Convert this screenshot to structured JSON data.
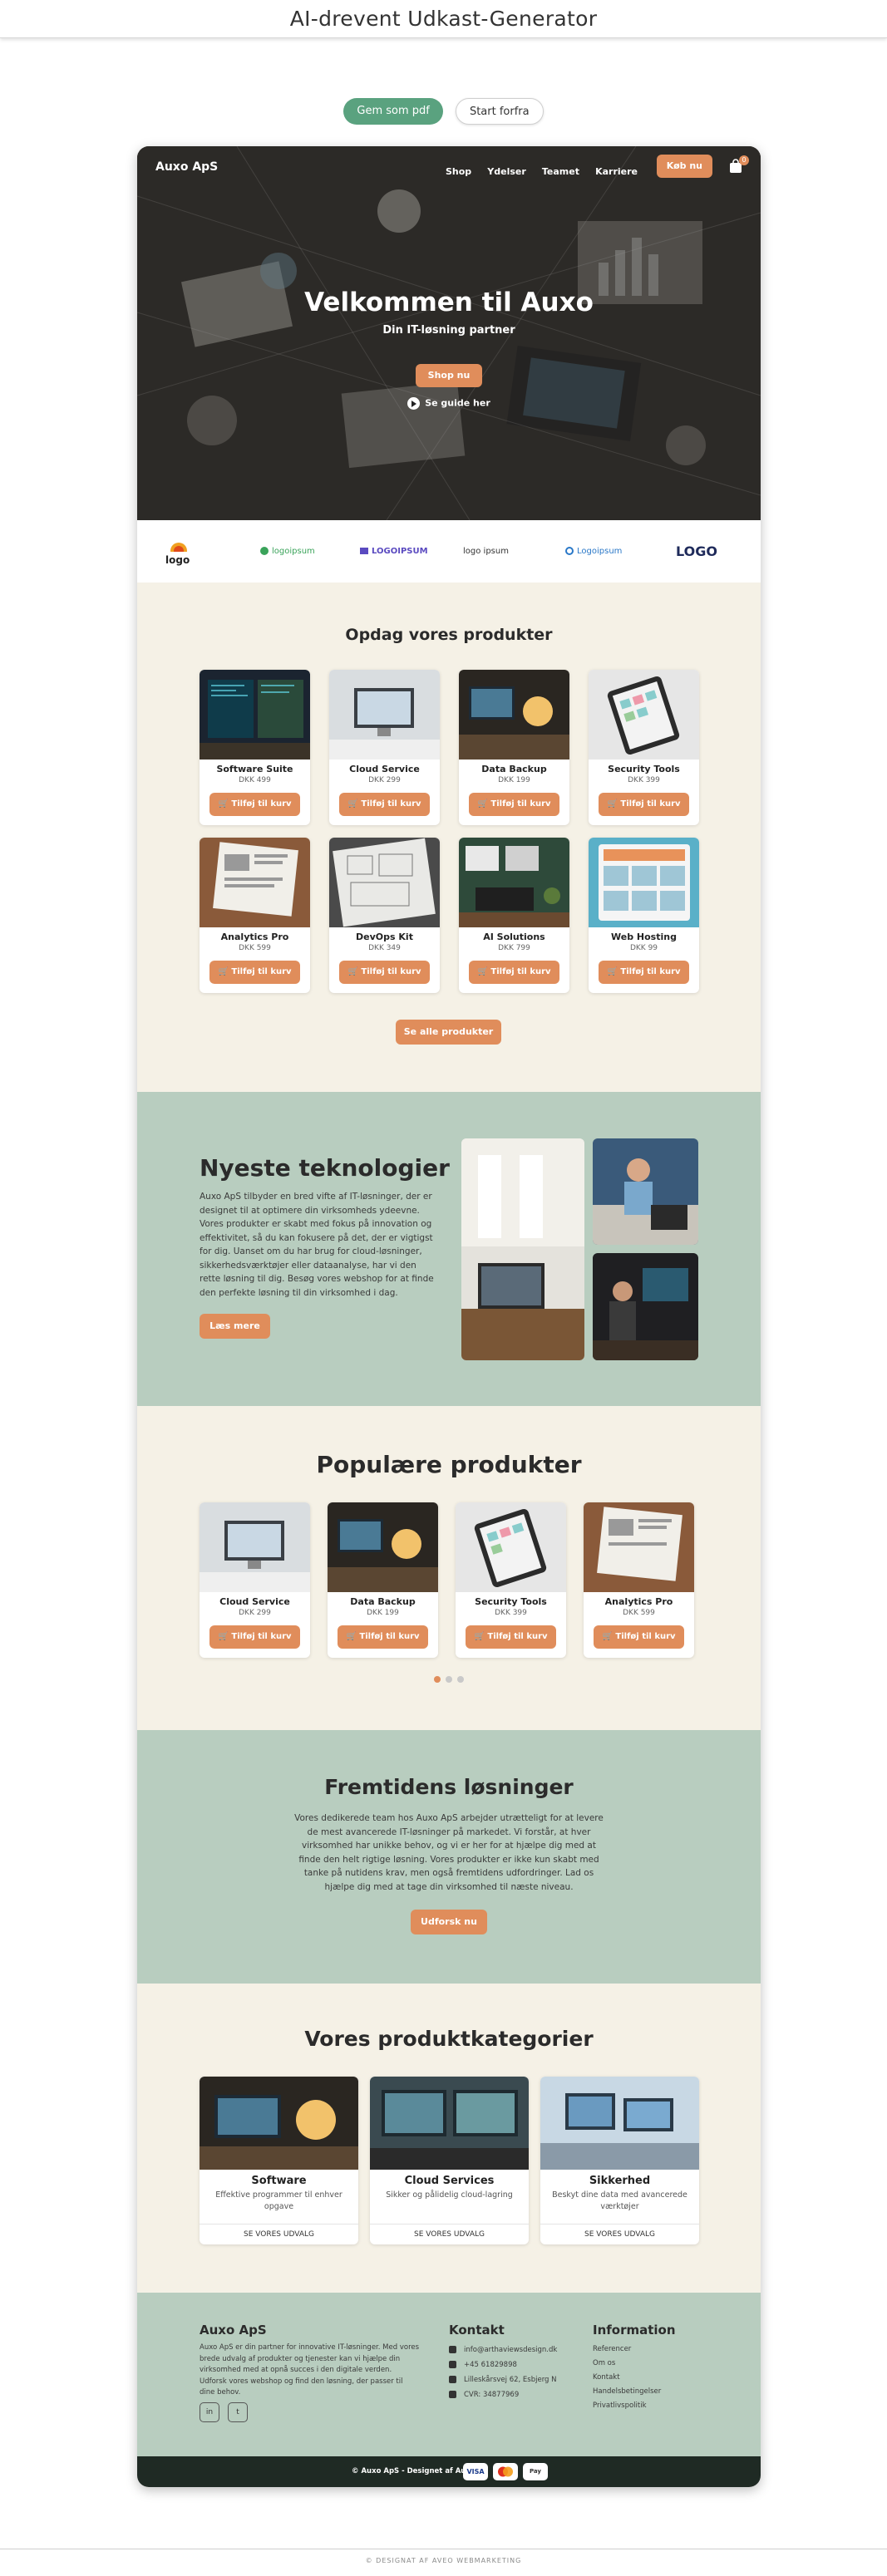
{
  "app": {
    "title": "AI-drevent Udkast-Generator",
    "save_pdf": "Gem som pdf",
    "restart": "Start forfra",
    "footer": "© DESIGNAT AF AVEO WEBMARKETING"
  },
  "nav": {
    "brand": "Auxo ApS",
    "links": [
      "Shop",
      "Ydelser",
      "Teamet",
      "Karriere"
    ],
    "cta": "Køb nu",
    "cart_count": "0"
  },
  "hero": {
    "title": "Velkommen til Auxo",
    "subtitle": "Din IT-løsning partner",
    "button": "Shop nu",
    "guide": "Se guide her"
  },
  "logos": [
    "logo",
    "logoipsum",
    "LOGOIPSUM",
    "logo ipsum",
    "Logoipsum",
    "LOGO"
  ],
  "products": {
    "title": "Opdag vores produkter",
    "add_label": "Tilføj til kurv",
    "items": [
      {
        "name": "Software Suite",
        "price": "DKK 499"
      },
      {
        "name": "Cloud Service",
        "price": "DKK 299"
      },
      {
        "name": "Data Backup",
        "price": "DKK 199"
      },
      {
        "name": "Security Tools",
        "price": "DKK 399"
      },
      {
        "name": "Analytics Pro",
        "price": "DKK 599"
      },
      {
        "name": "DevOps Kit",
        "price": "DKK 349"
      },
      {
        "name": "AI Solutions",
        "price": "DKK 799"
      },
      {
        "name": "Web Hosting",
        "price": "DKK 99"
      }
    ],
    "see_all": "Se alle produkter"
  },
  "tech": {
    "title": "Nyeste teknologier",
    "text": "Auxo ApS tilbyder en bred vifte af IT-løsninger, der er designet til at optimere din virksomheds ydeevne. Vores produkter er skabt med fokus på innovation og effektivitet, så du kan fokusere på det, der er vigtigst for dig. Uanset om du har brug for cloud-løsninger, sikkerhedsværktøjer eller dataanalyse, har vi den rette løsning til dig. Besøg vores webshop for at finde den perfekte løsning til din virksomhed i dag.",
    "button": "Læs mere"
  },
  "popular": {
    "title": "Populære produkter",
    "items": [
      {
        "name": "Cloud Service",
        "price": "DKK 299"
      },
      {
        "name": "Data Backup",
        "price": "DKK 199"
      },
      {
        "name": "Security Tools",
        "price": "DKK 399"
      },
      {
        "name": "Analytics Pro",
        "price": "DKK 599"
      }
    ],
    "active_dot": 1
  },
  "future": {
    "title": "Fremtidens løsninger",
    "text": "Vores dedikerede team hos Auxo ApS arbejder utrætteligt for at levere de mest avancerede IT-løsninger på markedet. Vi forstår, at hver virksomhed har unikke behov, og vi er her for at hjælpe dig med at finde den helt rigtige løsning. Vores produkter er ikke kun skabt med tanke på nutidens krav, men også fremtidens udfordringer. Lad os hjælpe dig med at tage din virksomhed til næste niveau.",
    "button": "Udforsk nu"
  },
  "categories": {
    "title": "Vores produktkategorier",
    "link_label": "SE VORES UDVALG",
    "items": [
      {
        "name": "Software",
        "desc": "Effektive programmer til enhver opgave"
      },
      {
        "name": "Cloud Services",
        "desc": "Sikker og pålidelig cloud-lagring"
      },
      {
        "name": "Sikkerhed",
        "desc": "Beskyt dine data med avancerede værktøjer"
      }
    ]
  },
  "footer": {
    "brand": "Auxo ApS",
    "about": "Auxo ApS er din partner for innovative IT-løsninger. Med vores brede udvalg af produkter og tjenester kan vi hjælpe din virksomhed med at opnå succes i den digitale verden. Udforsk vores webshop og find den løsning, der passer til dine behov.",
    "contact_title": "Kontakt",
    "contact": [
      "info@arthaviewsdesign.dk",
      "+45 61829898",
      "Lilleskårsvej 62, Esbjerg N",
      "CVR: 34877969"
    ],
    "info_title": "Information",
    "info_links": [
      "Referencer",
      "Om os",
      "Kontakt",
      "Handelsbetingelser",
      "Privatlivspolitik"
    ],
    "social": [
      "in",
      "t"
    ],
    "copyright": "© Auxo ApS - Designet af Auxo",
    "payments": [
      "VISA",
      "MC",
      "Pay"
    ]
  }
}
